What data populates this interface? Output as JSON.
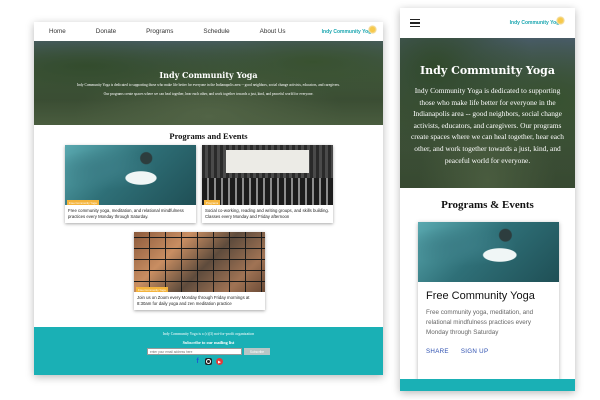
{
  "desktop": {
    "nav": {
      "items": [
        {
          "label": "Home"
        },
        {
          "label": "Donate"
        },
        {
          "label": "Programs"
        },
        {
          "label": "Schedule"
        },
        {
          "label": "About Us"
        }
      ],
      "brand": "Indy Community Yoga"
    },
    "hero": {
      "title": "Indy Community Yoga",
      "line1": "Indy Community Yoga is dedicated to supporting those who make life better for everyone in the Indianapolis area -- good neighbors, social change activists, educators, and caregivers.",
      "line2": "Our programs create spaces where we can heal together, hear each other, and work together towards a just, kind, and peaceful world for everyone."
    },
    "programs": {
      "title": "Programs and Events",
      "cards": [
        {
          "tag": "Free Community Yoga",
          "desc": "Free community yoga, meditation, and relational mindfulness practices every Monday through Saturday."
        },
        {
          "tag": "Programs",
          "desc": "Social co-working, reading and writing groups, and skills building. Classes every Monday and Friday afternoon"
        },
        {
          "tag": "Free Community Yoga",
          "desc": "Join us on Zoom every Monday through Friday mornings at 8:30am for daily yoga and zen meditation practice"
        }
      ]
    },
    "footer": {
      "org": "Indy Community Yoga is a (c)(3) not-for-profit organization",
      "subscribe_title": "Subscribe to our mailing list",
      "email_placeholder": "enter your email address here",
      "subscribe_button": "Subscribe",
      "socials": [
        {
          "icon": "facebook-icon"
        },
        {
          "icon": "instagram-icon"
        },
        {
          "icon": "youtube-icon"
        }
      ]
    }
  },
  "mobile": {
    "brand": "Indy Community Yoga",
    "hero": {
      "title": "Indy Community Yoga",
      "text": "Indy Community Yoga is dedicated to supporting those who make life better for everyone in the Indianapolis area -- good neighbors, social change activists, educators, and caregivers. Our programs create spaces where we can heal together, hear each other, and work together towards a just, kind, and peaceful world for everyone."
    },
    "programs_title": "Programs & Events",
    "card": {
      "title": "Free Community Yoga",
      "desc": "Free community yoga, meditation, and relational mindfulness practices every Monday through Saturday",
      "actions": [
        "SHARE",
        "SIGN UP"
      ]
    }
  },
  "colors": {
    "accent": "#1ab0b5",
    "tag": "#f4b43c",
    "link": "#2c4fb0"
  }
}
